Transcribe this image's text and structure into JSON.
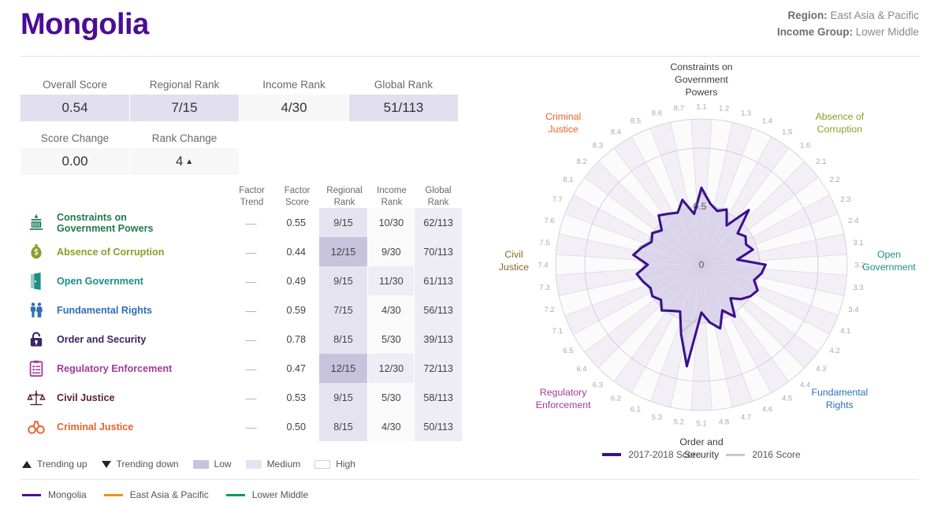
{
  "header": {
    "country": "Mongolia",
    "region_label": "Region:",
    "region_value": " East Asia & Pacific",
    "income_label": "Income Group:",
    "income_value": " Lower Middle"
  },
  "scorecards": {
    "row1": [
      {
        "label": "Overall Score",
        "value": "0.54",
        "band": "low"
      },
      {
        "label": "Regional Rank",
        "value": "7/15",
        "band": "med"
      },
      {
        "label": "Income Rank",
        "value": "4/30",
        "band": "high"
      },
      {
        "label": "Global Rank",
        "value": "51/113",
        "band": "low"
      }
    ],
    "row2": [
      {
        "label": "Score Change",
        "value": "0.00",
        "band": "high"
      },
      {
        "label": "Rank Change",
        "value": "4",
        "band": "high",
        "trend": "▲"
      }
    ]
  },
  "table": {
    "headers": {
      "factor": "",
      "trend_l1": "Factor",
      "trend_l2": "Trend",
      "score_l1": "Factor",
      "score_l2": "Score",
      "regional_l1": "Regional",
      "regional_l2": "Rank",
      "income_l1": "Income",
      "income_l2": "Rank",
      "global_l1": "Global",
      "global_l2": "Rank"
    },
    "rows": [
      {
        "name": "Constraints on\nGovernment Powers",
        "name_l1": "Constraints on",
        "name_l2": "Government Powers",
        "icon": "capitol-icon",
        "color": "#1f7a4d",
        "trend": "—",
        "score": "0.55",
        "regional": "9/15",
        "income": "10/30",
        "global": "62/113",
        "reg_band": "med",
        "inc_band": "high",
        "glob_band": "med2"
      },
      {
        "name": "Absence of Corruption",
        "name_l1": "Absence of Corruption",
        "name_l2": "",
        "icon": "money-bag-icon",
        "color": "#8a9e28",
        "trend": "—",
        "score": "0.44",
        "regional": "12/15",
        "income": "9/30",
        "global": "70/113",
        "reg_band": "low",
        "inc_band": "high",
        "glob_band": "med2"
      },
      {
        "name": "Open Government",
        "name_l1": "Open Government",
        "name_l2": "",
        "icon": "open-door-icon",
        "color": "#1c8f86",
        "trend": "—",
        "score": "0.49",
        "regional": "9/15",
        "income": "11/30",
        "global": "61/113",
        "reg_band": "med",
        "inc_band": "med2",
        "glob_band": "med2"
      },
      {
        "name": "Fundamental Rights",
        "name_l1": "Fundamental Rights",
        "name_l2": "",
        "icon": "people-icon",
        "color": "#2f6fb5",
        "trend": "—",
        "score": "0.59",
        "regional": "7/15",
        "income": "4/30",
        "global": "56/113",
        "reg_band": "med",
        "inc_band": "high",
        "glob_band": "med2"
      },
      {
        "name": "Order and Security",
        "name_l1": "Order and Security",
        "name_l2": "",
        "icon": "lock-icon",
        "color": "#3d2565",
        "trend": "—",
        "score": "0.78",
        "regional": "8/15",
        "income": "5/30",
        "global": "39/113",
        "reg_band": "med",
        "inc_band": "high",
        "glob_band": "med2"
      },
      {
        "name": "Regulatory Enforcement",
        "name_l1": "Regulatory Enforcement",
        "name_l2": "",
        "icon": "clipboard-icon",
        "color": "#a13b96",
        "trend": "—",
        "score": "0.47",
        "regional": "12/15",
        "income": "12/30",
        "global": "72/113",
        "reg_band": "low",
        "inc_band": "med2",
        "glob_band": "med2"
      },
      {
        "name": "Civil Justice",
        "name_l1": "Civil Justice",
        "name_l2": "",
        "icon": "scales-icon",
        "color": "#5b2331",
        "trend": "—",
        "score": "0.53",
        "regional": "9/15",
        "income": "5/30",
        "global": "58/113",
        "reg_band": "med",
        "inc_band": "high",
        "glob_band": "med2"
      },
      {
        "name": "Criminal Justice",
        "name_l1": "Criminal Justice",
        "name_l2": "",
        "icon": "handcuffs-icon",
        "color": "#e8622a",
        "trend": "—",
        "score": "0.50",
        "regional": "8/15",
        "income": "4/30",
        "global": "50/113",
        "reg_band": "med",
        "inc_band": "high",
        "glob_band": "med2"
      }
    ]
  },
  "legend_band": {
    "trending_up": "Trending up",
    "trending_down": "Trending down",
    "low": "Low",
    "medium": "Medium",
    "high": "High"
  },
  "legend_lines": [
    {
      "label": "Mongolia",
      "color": "#4b0d94"
    },
    {
      "label": "East Asia & Pacific",
      "color": "#e8951e"
    },
    {
      "label": "Lower Middle",
      "color": "#0d9c5a"
    }
  ],
  "chart_legend": [
    {
      "label": "2017-2018 Score",
      "color": "#3d0f8f"
    },
    {
      "label": "2016 Score",
      "color": "#c9c9c9"
    }
  ],
  "chart_data": {
    "type": "radar",
    "title": "",
    "center_label": "0",
    "ring_label": "0.5",
    "rmin": 0,
    "rmax": 1,
    "rings": [
      0.5,
      1.0
    ],
    "factor_labels": [
      {
        "id": "constraints",
        "l1": "Constraints on",
        "l2": "Government",
        "l3": "Powers",
        "color": "#3c3c3c"
      },
      {
        "id": "absence-of-corruption",
        "l1": "Absence of",
        "l2": "Corruption",
        "l3": "",
        "color": "#8a9e28"
      },
      {
        "id": "open-government",
        "l1": "Open",
        "l2": "Government",
        "l3": "",
        "color": "#1c8f86"
      },
      {
        "id": "fundamental-rights",
        "l1": "Fundamental",
        "l2": "Rights",
        "l3": "",
        "color": "#2f6fb5"
      },
      {
        "id": "order-and-security",
        "l1": "Order and",
        "l2": "Security",
        "l3": "",
        "color": "#3c3c3c"
      },
      {
        "id": "regulatory-enforcement",
        "l1": "Regulatory",
        "l2": "Enforcement",
        "l3": "",
        "color": "#a13b96"
      },
      {
        "id": "civil-justice",
        "l1": "Civil",
        "l2": "Justice",
        "l3": "",
        "color": "#8a6a2a"
      },
      {
        "id": "criminal-justice",
        "l1": "Criminal",
        "l2": "Justice",
        "l3": "",
        "color": "#e8622a"
      }
    ],
    "subfactors": [
      "1.1",
      "1.2",
      "1.3",
      "1.4",
      "1.5",
      "1.6",
      "2.1",
      "2.2",
      "2.3",
      "2.4",
      "3.1",
      "3.2",
      "3.3",
      "3.4",
      "4.1",
      "4.2",
      "4.3",
      "4.4",
      "4.5",
      "4.6",
      "4.7",
      "4.8",
      "5.1",
      "5.2",
      "5.3",
      "6.1",
      "6.2",
      "6.3",
      "6.4",
      "6.5",
      "7.1",
      "7.2",
      "7.3",
      "7.4",
      "7.5",
      "7.6",
      "7.7",
      "8.1",
      "8.2",
      "8.3",
      "8.4",
      "8.5",
      "8.6",
      "8.7"
    ],
    "series": [
      {
        "name": "2017-2018 Score",
        "color": "#3d0f8f",
        "values": [
          0.66,
          0.53,
          0.48,
          0.52,
          0.4,
          0.62,
          0.41,
          0.45,
          0.42,
          0.46,
          0.31,
          0.55,
          0.52,
          0.47,
          0.53,
          0.5,
          0.45,
          0.38,
          0.53,
          0.43,
          0.57,
          0.5,
          0.41,
          0.88,
          0.62,
          0.44,
          0.47,
          0.52,
          0.46,
          0.5,
          0.48,
          0.52,
          0.56,
          0.46,
          0.59,
          0.53,
          0.47,
          0.5,
          0.45,
          0.56,
          0.52,
          0.49,
          0.58,
          0.44
        ]
      },
      {
        "name": "2016 Score",
        "color": "#c9c9c9",
        "values": [
          0.62,
          0.53,
          0.5,
          0.53,
          0.42,
          0.6,
          0.42,
          0.44,
          0.42,
          0.46,
          0.32,
          0.54,
          0.53,
          0.47,
          0.52,
          0.5,
          0.46,
          0.39,
          0.52,
          0.45,
          0.56,
          0.49,
          0.42,
          0.5,
          0.6,
          0.45,
          0.48,
          0.5,
          0.45,
          0.49,
          0.49,
          0.51,
          0.55,
          0.48,
          0.57,
          0.55,
          0.48,
          0.51,
          0.46,
          0.55,
          0.51,
          0.5,
          0.56,
          0.45
        ]
      }
    ]
  }
}
